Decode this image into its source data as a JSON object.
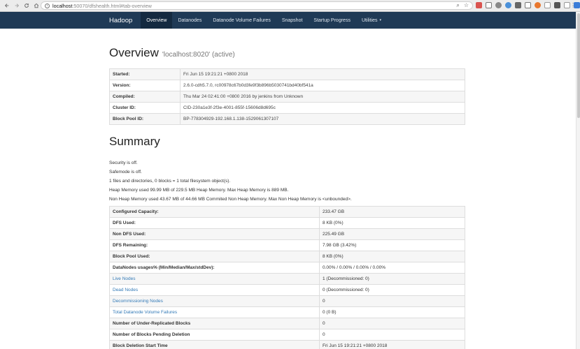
{
  "browser": {
    "url_host": "localhost",
    "url_rest": ":50070/dfshealth.html#tab-overview"
  },
  "navbar": {
    "brand": "Hadoop",
    "items": [
      {
        "label": "Overview",
        "active": true
      },
      {
        "label": "Datanodes"
      },
      {
        "label": "Datanode Volume Failures"
      },
      {
        "label": "Snapshot"
      },
      {
        "label": "Startup Progress"
      },
      {
        "label": "Utilities"
      }
    ]
  },
  "overview": {
    "title": "Overview",
    "subtitle": "'localhost:8020' (active)",
    "rows": [
      {
        "key": "Started:",
        "value": "Fri Jun 15 19:21:21 +0800 2018"
      },
      {
        "key": "Version:",
        "value": "2.6.0-cdh5.7.0, rc00978c67b0d3fe9f3b896b5030741bd40bf541a"
      },
      {
        "key": "Compiled:",
        "value": "Thu Mar 24 02:41:00 +0800 2016 by jenkins from Unknown"
      },
      {
        "key": "Cluster ID:",
        "value": "CID-230a1e3f-2f3e-4001-855f-15606d8d695c"
      },
      {
        "key": "Block Pool ID:",
        "value": "BP-778304929-192.168.1.138-1529061307107"
      }
    ]
  },
  "summary": {
    "title": "Summary",
    "lines": [
      "Security is off.",
      "Safemode is off.",
      "1 files and directories, 0 blocks = 1 total filesystem object(s).",
      "Heap Memory used 99.99 MB of 229.5 MB Heap Memory. Max Heap Memory is 889 MB.",
      "Non Heap Memory used 43.67 MB of 44.66 MB Commited Non Heap Memory. Max Non Heap Memory is <unbounded>."
    ],
    "rows": [
      {
        "key": "Configured Capacity:",
        "value": "233.47 GB"
      },
      {
        "key": "DFS Used:",
        "value": "8 KB (0%)"
      },
      {
        "key": "Non DFS Used:",
        "value": "225.49 GB"
      },
      {
        "key": "DFS Remaining:",
        "value": "7.98 GB (3.42%)"
      },
      {
        "key": "Block Pool Used:",
        "value": "8 KB (0%)"
      },
      {
        "key": "DataNodes usages% (Min/Median/Max/stdDev):",
        "value": "0.00% / 0.00% / 0.00% / 0.00%"
      },
      {
        "key": "Live Nodes",
        "value": "1 (Decommissioned: 0)",
        "link": true
      },
      {
        "key": "Dead Nodes",
        "value": "0 (Decommissioned: 0)",
        "link": true
      },
      {
        "key": "Decommissioning Nodes",
        "value": "0",
        "link": true
      },
      {
        "key": "Total Datanode Volume Failures",
        "value": "0 (0 B)",
        "link": true
      },
      {
        "key": "Number of Under-Replicated Blocks",
        "value": "0"
      },
      {
        "key": "Number of Blocks Pending Deletion",
        "value": "0"
      },
      {
        "key": "Block Deletion Start Time",
        "value": "Fri Jun 15 19:21:21 +0800 2018"
      }
    ]
  }
}
